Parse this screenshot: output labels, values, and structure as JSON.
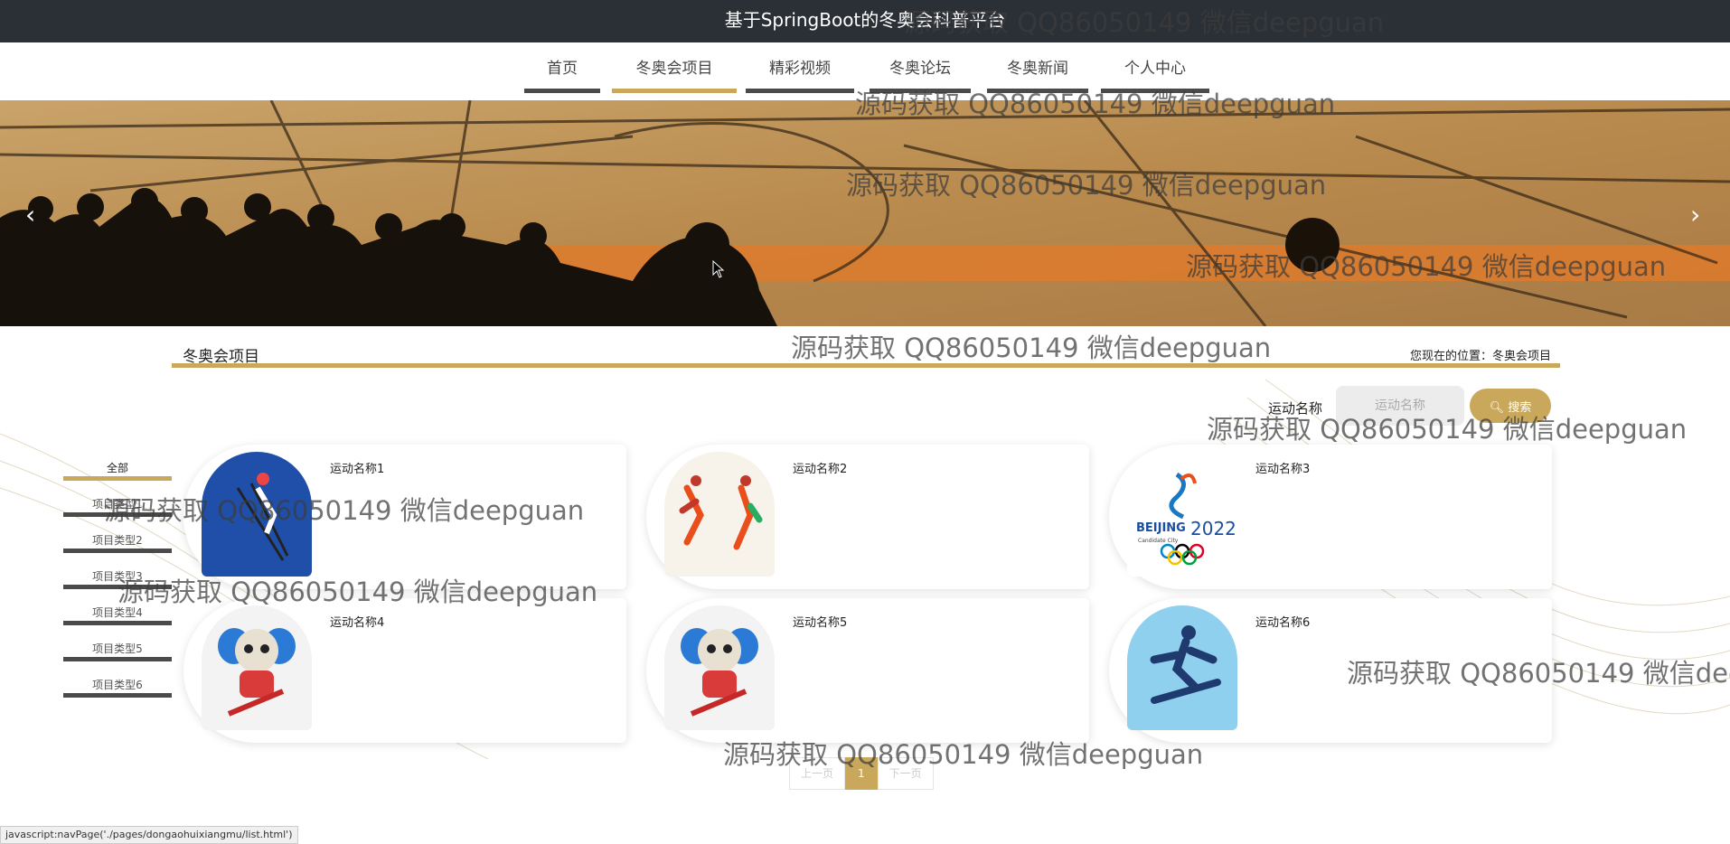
{
  "app": {
    "title": "基于SpringBoot的冬奥会科普平台"
  },
  "nav": {
    "items": [
      {
        "label": "首页"
      },
      {
        "label": "冬奥会项目"
      },
      {
        "label": "精彩视频"
      },
      {
        "label": "冬奥论坛"
      },
      {
        "label": "冬奥新闻"
      },
      {
        "label": "个人中心"
      }
    ],
    "active": "冬奥会项目"
  },
  "section": {
    "title": "冬奥会项目",
    "breadcrumb": "您现在的位置：冬奥会项目"
  },
  "search": {
    "label": "运动名称",
    "placeholder": "运动名称",
    "button": "搜索"
  },
  "sidebar": {
    "items": [
      {
        "label": "全部"
      },
      {
        "label": "项目类型1"
      },
      {
        "label": "项目类型2"
      },
      {
        "label": "项目类型3"
      },
      {
        "label": "项目类型4"
      },
      {
        "label": "项目类型5"
      },
      {
        "label": "项目类型6"
      }
    ]
  },
  "cards": [
    {
      "name": "运动名称1",
      "image": "ski-jumper-icon"
    },
    {
      "name": "运动名称2",
      "image": "pictogram-icon"
    },
    {
      "name": "运动名称3",
      "image": "beijing-2022-logo"
    },
    {
      "name": "运动名称4",
      "image": "hockey-mascot-icon"
    },
    {
      "name": "运动名称5",
      "image": "hockey-mascot-icon"
    },
    {
      "name": "运动名称6",
      "image": "snowboarder-icon"
    }
  ],
  "pagination": {
    "prev": "上一页",
    "current": "1",
    "next": "下一页"
  },
  "status_bar": "javascript:navPage('./pages/dongaohuixiangmu/list.html')",
  "watermark": "源码获取 QQ86050149 微信deepguan",
  "logo_text": {
    "city": "BEIJING",
    "year": "2022",
    "sub": "Candidate City"
  },
  "colors": {
    "accent": "#c9a85c",
    "topbar": "#2b2f36"
  }
}
